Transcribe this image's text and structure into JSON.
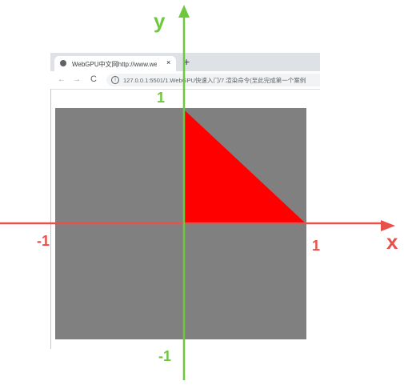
{
  "browser": {
    "tab_title": "WebGPU中文网http://www.we",
    "tab_close": "×",
    "new_tab": "+",
    "back": "←",
    "forward": "→",
    "reload": "C",
    "info": "i",
    "url": "127.0.0.1:5501/1.WebGPU快速入门/7.渲染命令(至此完成第一个案例"
  },
  "canvas": {
    "background": "#808080",
    "triangle_color": "#ff0000"
  },
  "axes": {
    "x_label": "x",
    "y_label": "y",
    "x_min_label": "-1",
    "x_max_label": "1",
    "y_min_label": "-1",
    "y_max_label": "1",
    "x_axis_color": "#e8514b",
    "y_axis_color": "#6ec83e"
  },
  "triangle": {
    "vertices": [
      [
        0,
        1
      ],
      [
        0,
        0
      ],
      [
        1,
        0
      ]
    ]
  }
}
